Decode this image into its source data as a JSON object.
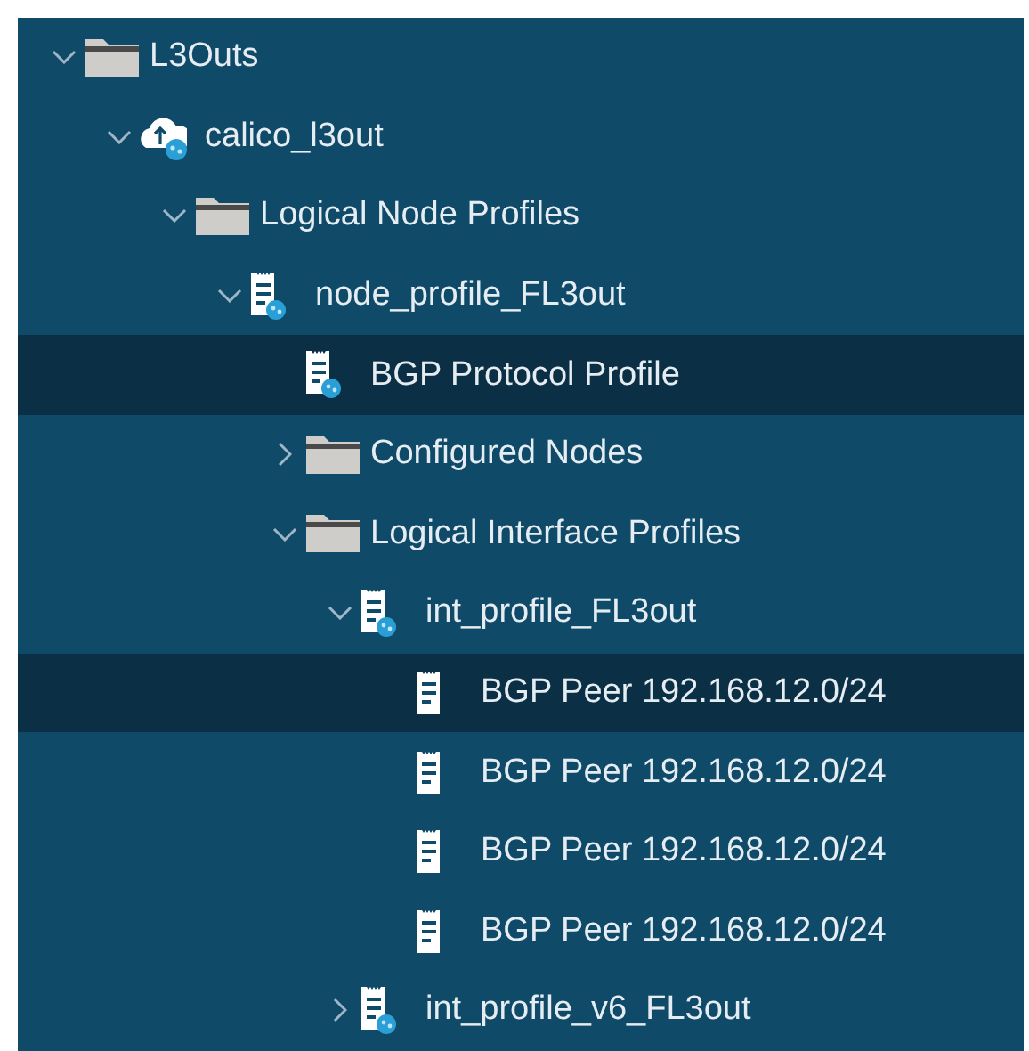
{
  "tree": [
    {
      "label": "L3Outs",
      "kind": "folder",
      "expanded": true,
      "selected": false,
      "children": [
        {
          "label": "calico_l3out",
          "kind": "cloud",
          "expanded": true,
          "selected": false,
          "children": [
            {
              "label": "Logical Node Profiles",
              "kind": "folder",
              "expanded": true,
              "selected": false,
              "children": [
                {
                  "label": "node_profile_FL3out",
                  "kind": "profile",
                  "expanded": true,
                  "selected": false,
                  "children": [
                    {
                      "label": "BGP Protocol Profile",
                      "kind": "profile",
                      "selected": true
                    },
                    {
                      "label": "Configured Nodes",
                      "kind": "folder",
                      "expanded": false,
                      "selected": false
                    },
                    {
                      "label": "Logical Interface Profiles",
                      "kind": "folder",
                      "expanded": true,
                      "selected": false,
                      "children": [
                        {
                          "label": "int_profile_FL3out",
                          "kind": "profile",
                          "expanded": true,
                          "selected": false,
                          "children": [
                            {
                              "label": "BGP Peer 192.168.12.0/24",
                              "kind": "doc",
                              "selected": true
                            },
                            {
                              "label": "BGP Peer 192.168.12.0/24",
                              "kind": "doc",
                              "selected": false
                            },
                            {
                              "label": "BGP Peer 192.168.12.0/24",
                              "kind": "doc",
                              "selected": false
                            },
                            {
                              "label": "BGP Peer 192.168.12.0/24",
                              "kind": "doc",
                              "selected": false
                            }
                          ]
                        },
                        {
                          "label": "int_profile_v6_FL3out",
                          "kind": "profile",
                          "expanded": false,
                          "selected": false
                        }
                      ]
                    }
                  ]
                }
              ]
            }
          ]
        }
      ]
    }
  ]
}
